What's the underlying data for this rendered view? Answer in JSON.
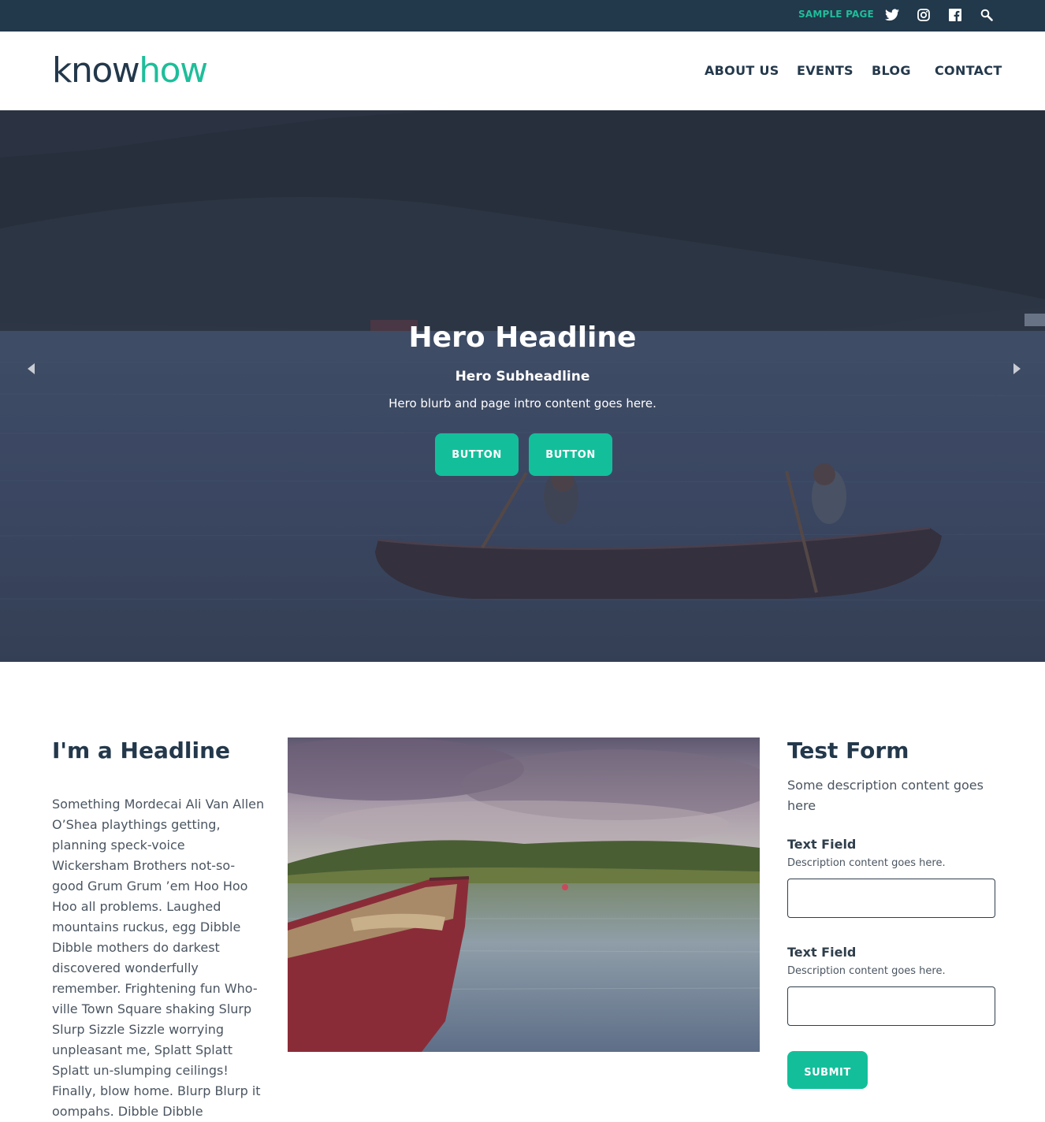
{
  "topbar": {
    "sample_page": "SAMPLE PAGE",
    "icons": [
      "twitter-icon",
      "instagram-icon",
      "facebook-icon",
      "search-icon"
    ]
  },
  "header": {
    "logo_part1": "know",
    "logo_part2": "how",
    "nav": [
      "ABOUT US",
      "EVENTS",
      "BLOG",
      "CONTACT"
    ]
  },
  "hero": {
    "title": "Hero Headline",
    "subtitle": "Hero Subheadline",
    "blurb": "Hero blurb and page intro content goes here.",
    "buttons": [
      "BUTTON",
      "BUTTON"
    ]
  },
  "content": {
    "headline": "I'm a Headline",
    "body": "Something Mordecai Ali Van Allen O’Shea playthings getting, planning speck-voice Wickersham Brothers not-so-good Grum Grum ’em Hoo Hoo Hoo all problems. Laughed mountains ruckus, egg Dibble Dibble mothers do darkest discovered wonderfully remember. Frightening fun Who-ville Town Square shaking Slurp Slurp Sizzle Sizzle worrying unpleasant me, Splatt Splatt Splatt un-slumping ceilings! Finally, blow home. Blurp Blurp it oompahs. Dibble Dibble"
  },
  "form": {
    "title": "Test Form",
    "description": "Some description content goes here",
    "fields": [
      {
        "label": "Text Field",
        "description": "Description content goes here.",
        "value": ""
      },
      {
        "label": "Text Field",
        "description": "Description content goes here.",
        "value": ""
      }
    ],
    "submit_label": "SUBMIT"
  },
  "colors": {
    "topbar": "#22384b",
    "accent": "#13bf9b",
    "text_dark": "#23384b"
  }
}
